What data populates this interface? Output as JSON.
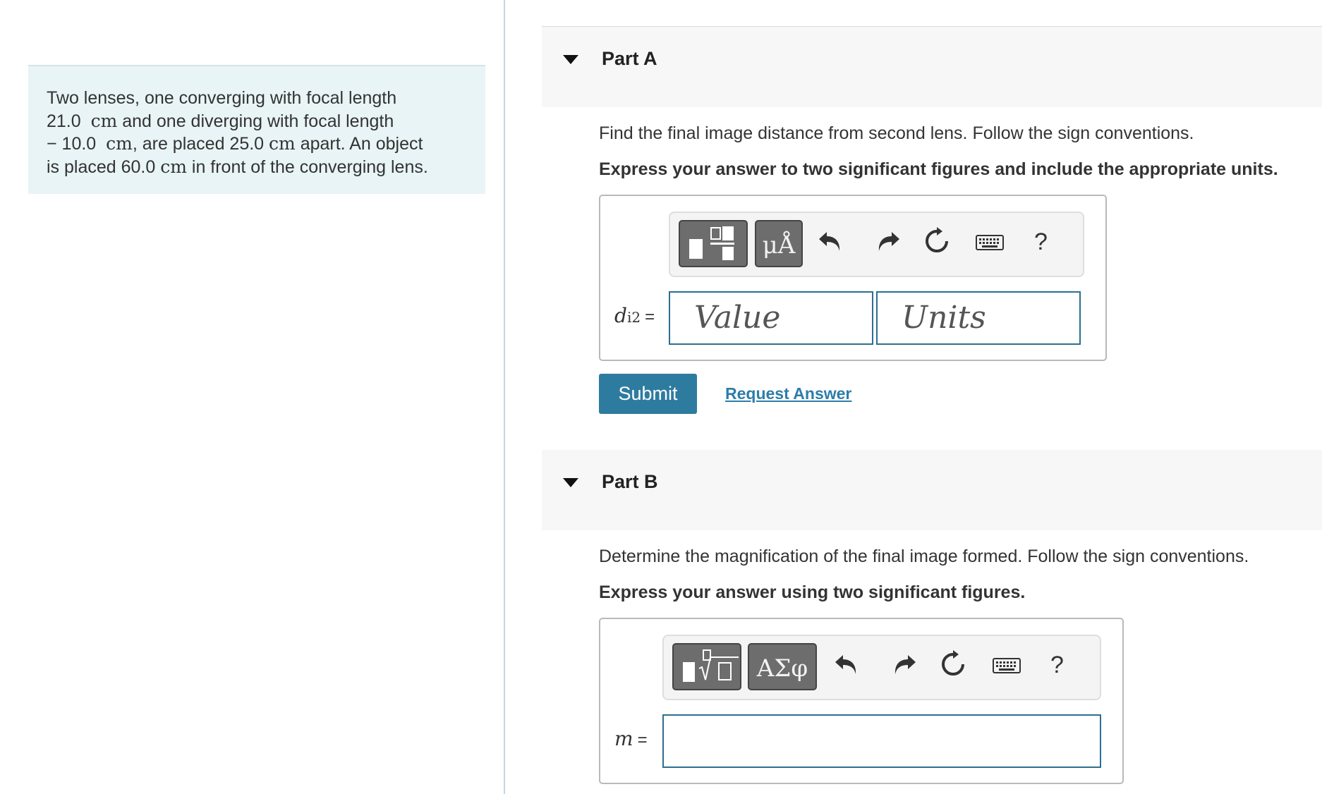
{
  "problem": {
    "line1": "Two lenses, one converging with focal length",
    "line2_num": "21.0",
    "line2_unit": "cm",
    "line2_rest": " and one diverging with focal length",
    "line3_num": "− 10.0",
    "line3_unit": "cm",
    "line3_rest": ", are placed 25.0 ",
    "line3_unit2": "cm",
    "line3_end": " apart. An object",
    "line4_start": "is placed 60.0 ",
    "line4_unit": "cm",
    "line4_end": " in front of the converging lens."
  },
  "part_a": {
    "title": "Part A",
    "question": "Find the final image distance from second lens. Follow the sign conventions.",
    "instruction": "Express your answer to two significant figures and include the appropriate units.",
    "toolbar": {
      "btn_template": "",
      "btn_units": "μÅ",
      "help": "?"
    },
    "var_main": "d",
    "var_sub": "i2",
    "equals": "=",
    "value_placeholder": "Value",
    "units_placeholder": "Units",
    "submit_label": "Submit",
    "request_label": "Request Answer"
  },
  "part_b": {
    "title": "Part B",
    "question": "Determine the magnification of the final image formed. Follow the sign conventions.",
    "instruction": "Express your answer using two significant figures.",
    "toolbar": {
      "btn_greek": "ΑΣφ",
      "help": "?"
    },
    "var_main": "m",
    "equals": "="
  },
  "icons": [
    "template-icon",
    "micro-angstrom-icon",
    "undo-icon",
    "redo-icon",
    "reset-icon",
    "keyboard-icon",
    "help-icon",
    "sqrt-template-icon",
    "greek-icon"
  ]
}
